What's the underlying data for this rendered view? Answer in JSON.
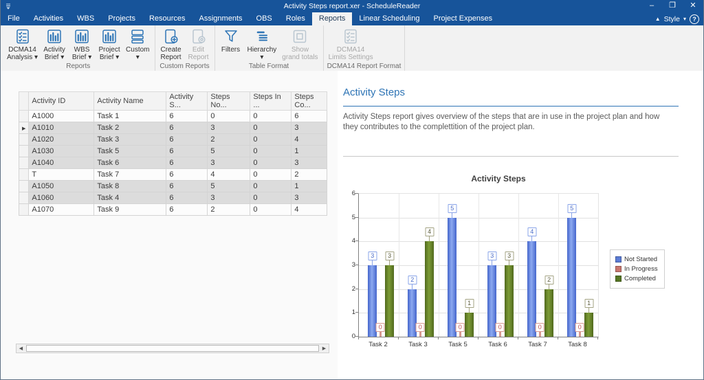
{
  "window": {
    "title": "Activity Steps report.xer - ScheduleReader",
    "controls": {
      "minimize": "–",
      "restore": "❐",
      "close": "✕"
    }
  },
  "menu": {
    "tabs": [
      "File",
      "Activities",
      "WBS",
      "Projects",
      "Resources",
      "Assignments",
      "OBS",
      "Roles",
      "Reports",
      "Linear Scheduling",
      "Project Expenses"
    ],
    "active_tab": "Reports",
    "style_label": "Style"
  },
  "ribbon": {
    "groups": [
      {
        "label": "Reports",
        "buttons": [
          {
            "label": "DCMA14\nAnalysis",
            "icon": "checklist-icon",
            "dropdown": "inline",
            "enabled": true
          },
          {
            "label": "Activity\nBrief",
            "icon": "bar-chart-icon",
            "dropdown": "inline",
            "enabled": true
          },
          {
            "label": "WBS\nBrief",
            "icon": "bar-chart-icon",
            "dropdown": "inline",
            "enabled": true
          },
          {
            "label": "Project\nBrief",
            "icon": "bar-chart-icon",
            "dropdown": "inline",
            "enabled": true
          },
          {
            "label": "Custom",
            "icon": "layers-icon",
            "dropdown": "below",
            "enabled": true
          }
        ]
      },
      {
        "label": "Custom Reports",
        "buttons": [
          {
            "label": "Create\nReport",
            "icon": "page-plus-icon",
            "dropdown": "none",
            "enabled": true
          },
          {
            "label": "Edit\nReport",
            "icon": "page-edit-icon",
            "dropdown": "none",
            "enabled": false
          }
        ]
      },
      {
        "label": "Table Format",
        "buttons": [
          {
            "label": "Filters",
            "icon": "funnel-icon",
            "dropdown": "none",
            "enabled": true
          },
          {
            "label": "Hierarchy",
            "icon": "hierarchy-icon",
            "dropdown": "below",
            "enabled": true
          },
          {
            "label": "Show\ngrand totals",
            "icon": "totals-icon",
            "dropdown": "none",
            "enabled": false
          }
        ]
      },
      {
        "label": "DCMA14 Report Format",
        "buttons": [
          {
            "label": "DCMA14\nLimits Settings",
            "icon": "checklist-icon",
            "dropdown": "none",
            "enabled": false
          }
        ]
      }
    ]
  },
  "table": {
    "columns": [
      "Activity ID",
      "Activity Name",
      "Activity S...",
      "Steps No...",
      "Steps In ...",
      "Steps Co..."
    ],
    "rows": [
      {
        "activity_id": "A1000",
        "activity_name": "Task 1",
        "values": [
          "6",
          "0",
          "0",
          "6"
        ],
        "shaded": false,
        "current": false
      },
      {
        "activity_id": "A1010",
        "activity_name": "Task 2",
        "values": [
          "6",
          "3",
          "0",
          "3"
        ],
        "shaded": true,
        "current": true
      },
      {
        "activity_id": "A1020",
        "activity_name": "Task 3",
        "values": [
          "6",
          "2",
          "0",
          "4"
        ],
        "shaded": true,
        "current": false
      },
      {
        "activity_id": "A1030",
        "activity_name": "Task 5",
        "values": [
          "6",
          "5",
          "0",
          "1"
        ],
        "shaded": true,
        "current": false
      },
      {
        "activity_id": "A1040",
        "activity_name": "Task 6",
        "values": [
          "6",
          "3",
          "0",
          "3"
        ],
        "shaded": true,
        "current": false
      },
      {
        "activity_id": "T",
        "activity_name": "Task 7",
        "values": [
          "6",
          "4",
          "0",
          "2"
        ],
        "shaded": false,
        "current": false
      },
      {
        "activity_id": "A1050",
        "activity_name": "Task 8",
        "values": [
          "6",
          "5",
          "0",
          "1"
        ],
        "shaded": true,
        "current": false
      },
      {
        "activity_id": "A1060",
        "activity_name": "Task 4",
        "values": [
          "6",
          "3",
          "0",
          "3"
        ],
        "shaded": true,
        "current": false
      },
      {
        "activity_id": "A1070",
        "activity_name": "Task 9",
        "values": [
          "6",
          "2",
          "0",
          "4"
        ],
        "shaded": false,
        "current": false
      }
    ]
  },
  "report": {
    "title": "Activity Steps",
    "description": "Activity Steps report gives overview of the steps that are in use in the project plan and how they contributes to the complettition of the project plan."
  },
  "chart_data": {
    "type": "bar",
    "title": "Activity Steps",
    "categories": [
      "Task 2",
      "Task 3",
      "Task 5",
      "Task 6",
      "Task 7",
      "Task 8"
    ],
    "series": [
      {
        "name": "Not Started",
        "color": "#5b7bd5",
        "values": [
          3,
          2,
          5,
          3,
          4,
          5
        ]
      },
      {
        "name": "In Progress",
        "color": "#c9766e",
        "values": [
          0,
          0,
          0,
          0,
          0,
          0
        ]
      },
      {
        "name": "Completed",
        "color": "#567623",
        "values": [
          3,
          4,
          1,
          3,
          2,
          1
        ]
      }
    ],
    "ylim": [
      0,
      6
    ],
    "yticks": [
      0,
      1,
      2,
      3,
      4,
      5,
      6
    ],
    "grid": true,
    "legend_position": "right",
    "data_labels": true
  }
}
